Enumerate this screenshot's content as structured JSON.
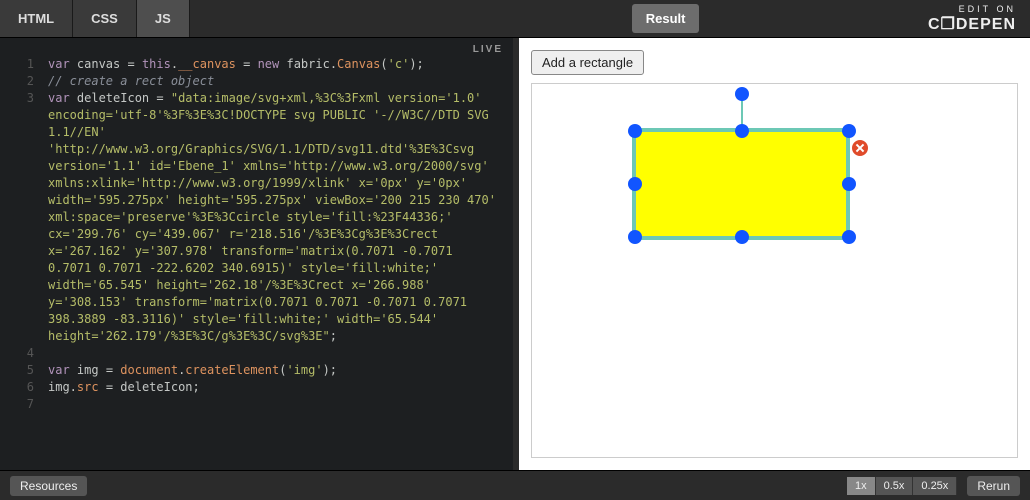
{
  "tabs": {
    "html": "HTML",
    "css": "CSS",
    "js": "JS",
    "active": "JS"
  },
  "result_label": "Result",
  "brand": {
    "edit": "EDIT ON",
    "logo": "C❒DEPEN"
  },
  "live_badge": "LIVE",
  "code": {
    "lines": [
      {
        "n": "1",
        "segs": [
          [
            "kw",
            "var"
          ],
          [
            "op",
            " canvas "
          ],
          [
            "op",
            "= "
          ],
          [
            "kw",
            "this"
          ],
          [
            "op",
            "."
          ],
          [
            "glb",
            "__canvas"
          ],
          [
            "op",
            " = "
          ],
          [
            "kw",
            "new"
          ],
          [
            "op",
            " fabric."
          ],
          [
            "glb",
            "Canvas"
          ],
          [
            "op",
            "("
          ],
          [
            "str",
            "'c'"
          ],
          [
            "op",
            ");"
          ]
        ]
      },
      {
        "n": "2",
        "segs": [
          [
            "cmt",
            "// create a rect object"
          ]
        ]
      },
      {
        "n": "3",
        "segs": [
          [
            "kw",
            "var"
          ],
          [
            "op",
            " deleteIcon "
          ],
          [
            "op",
            "= "
          ],
          [
            "str",
            "\"data:image/svg+xml,%3C%3Fxml version='1.0' encoding='utf-8'%3F%3E%3C!DOCTYPE svg PUBLIC '-//W3C//DTD SVG 1.1//EN' 'http://www.w3.org/Graphics/SVG/1.1/DTD/svg11.dtd'%3E%3Csvg version='1.1' id='Ebene_1' xmlns='http://www.w3.org/2000/svg' xmlns:xlink='http://www.w3.org/1999/xlink' x='0px' y='0px' width='595.275px' height='595.275px' viewBox='200 215 230 470' xml:space='preserve'%3E%3Ccircle style='fill:%23F44336;' cx='299.76' cy='439.067' r='218.516'/%3E%3Cg%3E%3Crect x='267.162' y='307.978' transform='matrix(0.7071 -0.7071 0.7071 0.7071 -222.6202 340.6915)' style='fill:white;' width='65.545' height='262.18'/%3E%3Crect x='266.988' y='308.153' transform='matrix(0.7071 0.7071 -0.7071 0.7071 398.3889 -83.3116)' style='fill:white;' width='65.544' height='262.179'/%3E%3C/g%3E%3C/svg%3E\""
          ],
          [
            "op",
            ";"
          ]
        ]
      },
      {
        "n": "4",
        "segs": [
          [
            "op",
            ""
          ]
        ]
      },
      {
        "n": "5",
        "segs": [
          [
            "kw",
            "var"
          ],
          [
            "op",
            " img "
          ],
          [
            "op",
            "= "
          ],
          [
            "glb",
            "document"
          ],
          [
            "op",
            "."
          ],
          [
            "glb",
            "createElement"
          ],
          [
            "op",
            "("
          ],
          [
            "str",
            "'img'"
          ],
          [
            "op",
            ");"
          ]
        ]
      },
      {
        "n": "6",
        "segs": [
          [
            "op",
            "img."
          ],
          [
            "glb",
            "src"
          ],
          [
            "op",
            " = deleteIcon;"
          ]
        ]
      },
      {
        "n": "7",
        "segs": [
          [
            "op",
            ""
          ]
        ]
      }
    ]
  },
  "result": {
    "add_button": "Add a rectangle"
  },
  "canvas": {
    "rect": {
      "fill": "#ffff00",
      "stroke": "#6cc8b5"
    },
    "handle_color": "#1155ff",
    "delete_icon_color": "#e04b2b"
  },
  "bottombar": {
    "resources": "Resources",
    "zooms": [
      "1x",
      "0.5x",
      "0.25x"
    ],
    "zoom_active": "1x",
    "rerun": "Rerun"
  }
}
